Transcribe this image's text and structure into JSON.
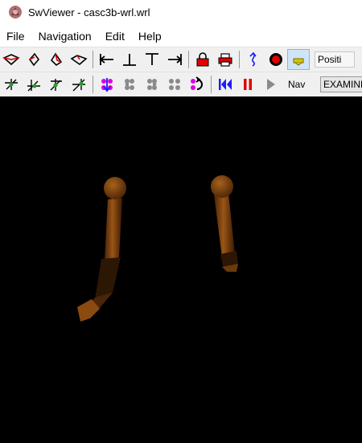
{
  "window": {
    "title": "SwViewer - casc3b-wrl.wrl",
    "app_icon": "swviewer-app-icon"
  },
  "menubar": {
    "items": [
      {
        "label": "File"
      },
      {
        "label": "Navigation"
      },
      {
        "label": "Edit"
      },
      {
        "label": "Help"
      }
    ]
  },
  "toolbar1": {
    "buttons": [
      "view-front-icon",
      "view-rotate-left-icon",
      "view-rotate-right-icon",
      "view-top-icon",
      "align-left-icon",
      "align-bottom-icon",
      "align-top-icon",
      "align-right-icon",
      "lock-icon",
      "print-lock-icon",
      "navigate-pointer-icon",
      "record-icon",
      "headlight-icon"
    ],
    "position_field": "Positi"
  },
  "toolbar2": {
    "buttons": [
      "axis-xy-icon",
      "axis-xz-icon",
      "axis-yz-icon",
      "axis-free-icon",
      "step-marker-icon",
      "step-back-icon",
      "step-forward-icon",
      "step-pair-icon",
      "reset-step-icon",
      "rewind-icon",
      "pause-icon",
      "play-icon"
    ],
    "nav_label": "Nav",
    "nav_mode": "EXAMINE"
  },
  "colors": {
    "accent_blue": "#1a1aff",
    "magenta": "#e000e0",
    "red": "#e00000",
    "arm_brown": "#8a4a10",
    "viewport_bg": "#000000"
  }
}
